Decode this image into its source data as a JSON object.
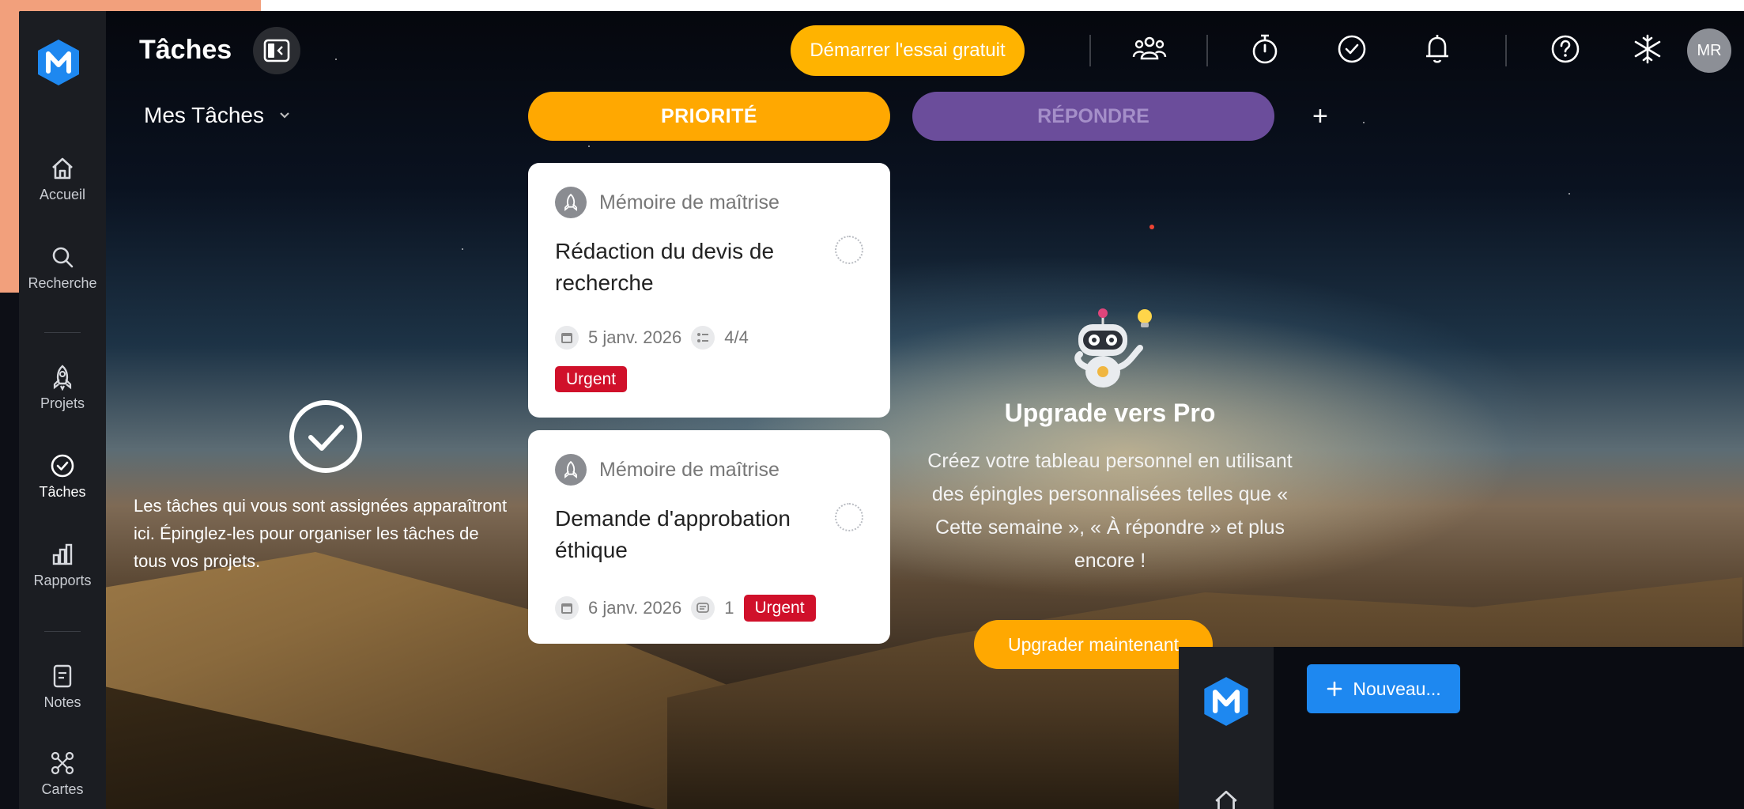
{
  "app": {
    "title": "Tâches",
    "user_initials": "MR"
  },
  "sidebar": {
    "items": [
      {
        "label": "Accueil",
        "icon": "home-icon"
      },
      {
        "label": "Recherche",
        "icon": "search-icon"
      },
      {
        "label": "Projets",
        "icon": "rocket-icon"
      },
      {
        "label": "Tâches",
        "icon": "check-circle-icon"
      },
      {
        "label": "Rapports",
        "icon": "bar-chart-icon"
      },
      {
        "label": "Notes",
        "icon": "note-icon"
      },
      {
        "label": "Cartes",
        "icon": "mindmap-icon"
      }
    ]
  },
  "topbar": {
    "trial_label": "Démarrer l'essai gratuit",
    "icons": [
      "team-icon",
      "stopwatch-icon",
      "check-circle-icon",
      "bell-icon",
      "help-icon",
      "snowflake-icon"
    ]
  },
  "subbar": {
    "view_label": "Mes Tâches",
    "columns": [
      {
        "label": "PRIORITÉ",
        "color": "#ffa801"
      },
      {
        "label": "RÉPONDRE",
        "color": "#6b4d9b"
      }
    ],
    "add_label": "+"
  },
  "empty_state": {
    "text": "Les tâches qui vous sont assignées apparaîtront ici. Épinglez-les pour organiser les tâches de tous vos projets."
  },
  "cards": [
    {
      "project": "Mémoire de maîtrise",
      "name": "Rédaction du devis de recherche",
      "date": "5 janv. 2026",
      "subtasks": "4/4",
      "badge": "Urgent"
    },
    {
      "project": "Mémoire de maîtrise",
      "name": "Demande d'approbation éthique",
      "date": "6 janv. 2026",
      "comments": "1",
      "badge": "Urgent"
    }
  ],
  "promo": {
    "title": "Upgrade vers Pro",
    "text": "Créez votre tableau personnel en utilisant des épingles personnalisées telles que « Cette semaine », « À répondre » et plus encore !",
    "button": "Upgrader maintenant"
  },
  "overlay": {
    "new_button": "Nouveau..."
  },
  "colors": {
    "accent": "#ffa801",
    "trial": "#ffb300",
    "urgent": "#d0102a",
    "logo": "#1e88f0",
    "respond": "#6b4d9b"
  }
}
